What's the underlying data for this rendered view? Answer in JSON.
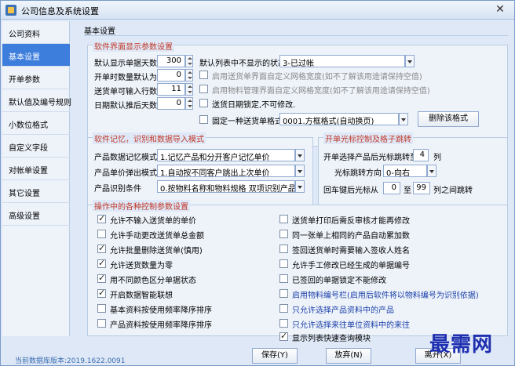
{
  "window": {
    "title": "公司信息及系统设置",
    "close_label": "✕"
  },
  "sidebar": {
    "items": [
      {
        "label": "公司资料"
      },
      {
        "label": "基本设置",
        "active": true
      },
      {
        "label": "开单参数"
      },
      {
        "label": "默认值及编号规则"
      },
      {
        "label": "小数位格式"
      },
      {
        "label": "自定义字段"
      },
      {
        "label": "对帐单设置"
      },
      {
        "label": "其它设置"
      },
      {
        "label": "高级设置"
      }
    ]
  },
  "main": {
    "title": "基本设置"
  },
  "ui_params": {
    "legend": "软件界面显示参数设置",
    "fields": [
      {
        "label": "默认显示单据天数",
        "value": "300"
      },
      {
        "label": "开单时数量默认为",
        "value": "0"
      },
      {
        "label": "送货单可输入行数",
        "value": "11"
      },
      {
        "label": "日期默认推后天数",
        "value": "0"
      }
    ],
    "hidden_status_label": "默认列表中不显示的状态",
    "hidden_status_value": "3-已过帐",
    "opt1": "启用送货单界面自定义网格宽度(如不了解该用途请保持空值)",
    "opt2": "启用物料管理界面自定义网格宽度(如不了解该用途请保持空值)",
    "opt3": "送货日期锁定,不可修改.",
    "fixed_format_label": "固定一种送货单格式",
    "fixed_format_value": "0001.方框格式(自动换页)",
    "delete_format_button": "删除该格式"
  },
  "memory": {
    "legend": "软件记忆，识别和数据导入模式",
    "rows": [
      {
        "label": "产品数据记忆模式",
        "value": "1.记忆产品和分开客户记忆单价"
      },
      {
        "label": "产品单价弹出模式",
        "value": "1.自动按不同客户跳出上次单价"
      },
      {
        "label": "产品识别条件",
        "value": "0.按物料名称和物料规格 双项识别产品"
      }
    ]
  },
  "cursor": {
    "legend": "开单光标控制及格子跳转",
    "jump_label": "开单选择产品后光标跳转至",
    "jump_value": "4",
    "jump_unit": "列",
    "direction_label": "光标跳转方向",
    "direction_value": "0-向右",
    "enter_label": "回车键后光标从",
    "enter_from": "0",
    "enter_to_label": "至",
    "enter_to": "99",
    "enter_suffix": "列之间跳转"
  },
  "ops": {
    "legend": "操作中的各种控制参数设置",
    "left": [
      {
        "label": "允许不输入送货单的单价",
        "checked": true
      },
      {
        "label": "允许手动更改送货单总金额",
        "checked": false
      },
      {
        "label": "允许批量删除送货单(慎用)",
        "checked": true
      },
      {
        "label": "允许送货数量为零",
        "checked": true
      },
      {
        "label": "用不同颜色区分单据状态",
        "checked": true
      },
      {
        "label": "开启数据智能联想",
        "checked": true
      },
      {
        "label": "基本资料按使用频率降序排序",
        "checked": false
      },
      {
        "label": "产品资料按使用频率降序排序",
        "checked": false
      }
    ],
    "right": [
      {
        "label": "送货单打印后需反审核才能再修改",
        "checked": false,
        "blue": false
      },
      {
        "label": "同一张单上相同的产品自动累加数",
        "checked": false,
        "blue": false
      },
      {
        "label": "签回送货单时需要输入签收人姓名",
        "checked": false,
        "blue": false
      },
      {
        "label": "允许手工修改已经生成的单据编号",
        "checked": false,
        "blue": false
      },
      {
        "label": "已签回的单据锁定不能修改",
        "checked": false,
        "blue": false
      },
      {
        "label": "启用物料编号栏(启用后软件将以物料编号为识别依据)",
        "checked": false,
        "blue": true
      },
      {
        "label": "只允许选择产品资料中的产品",
        "checked": false,
        "blue": true
      },
      {
        "label": "只允许选择来往单位资料中的来往",
        "checked": false,
        "blue": true
      },
      {
        "label": "显示列表快速查询模块",
        "checked": true,
        "blue": false
      }
    ]
  },
  "footer": {
    "db_version": "当前数据库版本:2019.1622.0091",
    "save": "保存(Y)",
    "discard": "放弃(N)",
    "exit": "离开(X)",
    "watermark": "最需网"
  }
}
